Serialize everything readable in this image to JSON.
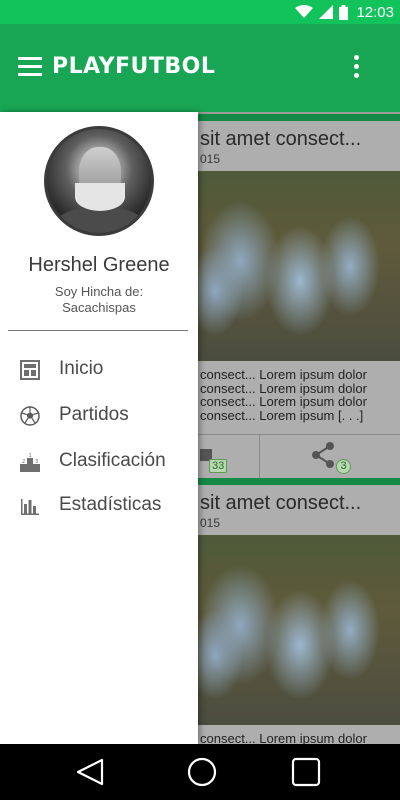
{
  "status_bar": {
    "time": "12:03",
    "colors": {
      "background": "#12c35c"
    },
    "icons": [
      "wifi-icon",
      "signal-icon",
      "battery-icon"
    ]
  },
  "app_bar": {
    "title": "PLAYFUTBOL",
    "menu_icon": "hamburger-icon",
    "overflow_icon": "more-vert-icon",
    "color": "#19a654"
  },
  "drawer": {
    "user_name": "Hershel Greene",
    "fan_line1": "Soy Hincha de:",
    "fan_line2": "Sacachispas",
    "items": [
      {
        "label": "Inicio",
        "icon": "home-icon"
      },
      {
        "label": "Partidos",
        "icon": "soccer-ball-icon"
      },
      {
        "label": "Clasificación",
        "icon": "podium-icon"
      },
      {
        "label": "Estadísticas",
        "icon": "bar-chart-icon"
      }
    ]
  },
  "feed": {
    "cards": [
      {
        "title": "sit amet consect...",
        "date": "015",
        "text_lines": [
          "consect... Lorem ipsum dolor",
          "consect... Lorem ipsum dolor",
          "consect... Lorem ipsum dolor",
          "consect... Lorem ipsum [. . .]"
        ],
        "comments_count": "33",
        "shares_count": "3"
      },
      {
        "title": "sit amet consect...",
        "date": "015",
        "text_lines": [
          "consect... Lorem ipsum dolor"
        ]
      }
    ]
  },
  "nav_bar": {
    "back_icon": "back-icon",
    "home_icon": "home-circle-icon",
    "recents_icon": "recents-icon"
  }
}
